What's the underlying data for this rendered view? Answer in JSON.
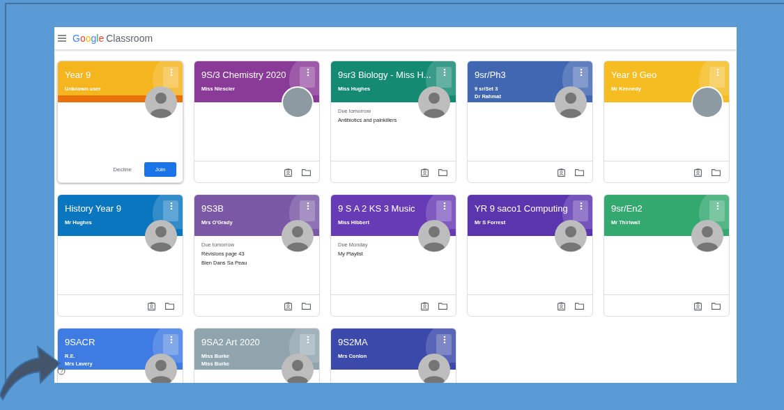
{
  "app_bar": {
    "brand": "Google",
    "product": "Classroom"
  },
  "cards": [
    {
      "kind": "invite",
      "title": "Year 9",
      "color": "#f5b51f",
      "lines": [
        "Unknown user"
      ],
      "avatar": {
        "kind": "default"
      },
      "actions": [
        "Decline",
        "Join"
      ]
    },
    {
      "kind": "class",
      "title": "9S/3 Chemistry 2020",
      "color": "#8a3b98",
      "lines": [
        "Miss Niescier"
      ],
      "avatar": {
        "kind": "photo"
      }
    },
    {
      "kind": "class",
      "title": "9sr3 Biology - Miss H...",
      "color": "#148a73",
      "lines": [
        "Miss Hughes"
      ],
      "avatar": {
        "kind": "default"
      },
      "due": {
        "label": "Due tomorrow",
        "items": [
          "Antibiotics and painkillers"
        ]
      }
    },
    {
      "kind": "class",
      "title": "9sr/Ph3",
      "color": "#4267b2",
      "lines": [
        "9 sr/Set 3",
        "Dr Rahmat"
      ],
      "avatar": {
        "kind": "default"
      }
    },
    {
      "kind": "class",
      "title": "Year 9 Geo",
      "color": "#f5bd22",
      "lines": [
        "Mr Kennedy"
      ],
      "avatar": {
        "kind": "photo"
      }
    },
    {
      "kind": "class",
      "title": "History Year 9",
      "color": "#0b76c0",
      "lines": [
        "Mr Hughes"
      ],
      "avatar": {
        "kind": "default"
      }
    },
    {
      "kind": "class",
      "title": "9S3B",
      "color": "#7a58a6",
      "lines": [
        "Mrs O'Grady"
      ],
      "avatar": {
        "kind": "default"
      },
      "due": {
        "label": "Due tomorrow",
        "items": [
          "Révisions page 43",
          "Bien Dans Sa Peau"
        ]
      }
    },
    {
      "kind": "class",
      "title": "9 S A 2 KS 3 Music",
      "color": "#683bb6",
      "lines": [
        "Miss Hibbert"
      ],
      "avatar": {
        "kind": "default"
      },
      "due": {
        "label": "Due Monday",
        "items": [
          "My Playlist"
        ]
      }
    },
    {
      "kind": "class",
      "title": "YR 9 saco1 Computing",
      "color": "#5b35ae",
      "lines": [
        "Mr S Forrest"
      ],
      "avatar": {
        "kind": "default"
      }
    },
    {
      "kind": "class",
      "title": "9sr/En2",
      "color": "#34a96f",
      "lines": [
        "Mr Thirlwall"
      ],
      "avatar": {
        "kind": "default"
      }
    },
    {
      "kind": "class",
      "title": "9SACR",
      "color": "#3e7be2",
      "lines": [
        "R.E.",
        "Mrs Lavery"
      ],
      "avatar": {
        "kind": "default"
      }
    },
    {
      "kind": "class",
      "title": "9SA2 Art 2020",
      "color": "#90a4ae",
      "lines": [
        "Miss Burke",
        "Miss Burke"
      ],
      "avatar": {
        "kind": "default"
      }
    },
    {
      "kind": "class",
      "title": "9S2MA",
      "color": "#3a49aa",
      "lines": [
        "Mrs Conlon"
      ],
      "avatar": {
        "kind": "default"
      }
    }
  ]
}
